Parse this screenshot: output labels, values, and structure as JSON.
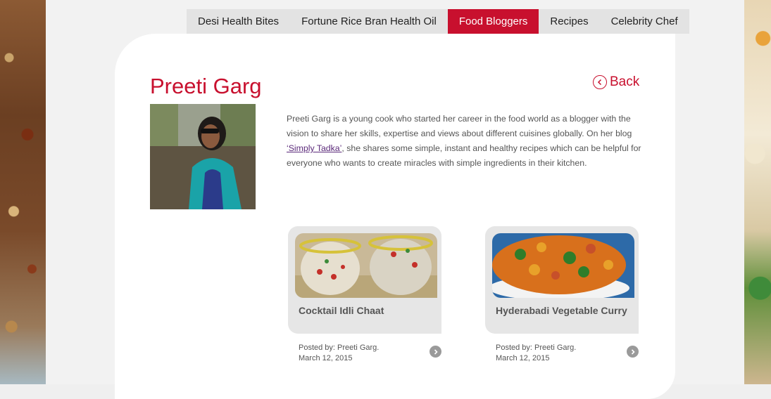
{
  "nav": {
    "items": [
      {
        "label": "Desi Health Bites",
        "active": false
      },
      {
        "label": "Fortune Rice Bran Health Oil",
        "active": false
      },
      {
        "label": "Food Bloggers",
        "active": true
      },
      {
        "label": "Recipes",
        "active": false
      },
      {
        "label": "Celebrity Chef",
        "active": false
      }
    ],
    "active_color": "#c8102e"
  },
  "blogger": {
    "name": "Preeti Garg",
    "back_label": "Back",
    "bio_before_link": "Preeti Garg is a young cook who started her career in the food world as a blogger with the vision to share her skills, expertise and views about different cuisines globally. On her blog ",
    "bio_link": "‘Simply Tadka’",
    "bio_after_link": ", she shares some simple, instant and healthy recipes which can be helpful for everyone who wants to create miracles with simple ingredients in their kitchen."
  },
  "recipes": [
    {
      "title": "Cocktail Idli Chaat",
      "posted_by": "Posted by: Preeti Garg.",
      "date": "March 12, 2015"
    },
    {
      "title": "Hyderabadi Vegetable Curry",
      "posted_by": "Posted by: Preeti Garg.",
      "date": "March 12, 2015"
    }
  ],
  "icons": {
    "back": "chevron-left-circle-icon",
    "more": "chevron-right-circle-icon"
  }
}
